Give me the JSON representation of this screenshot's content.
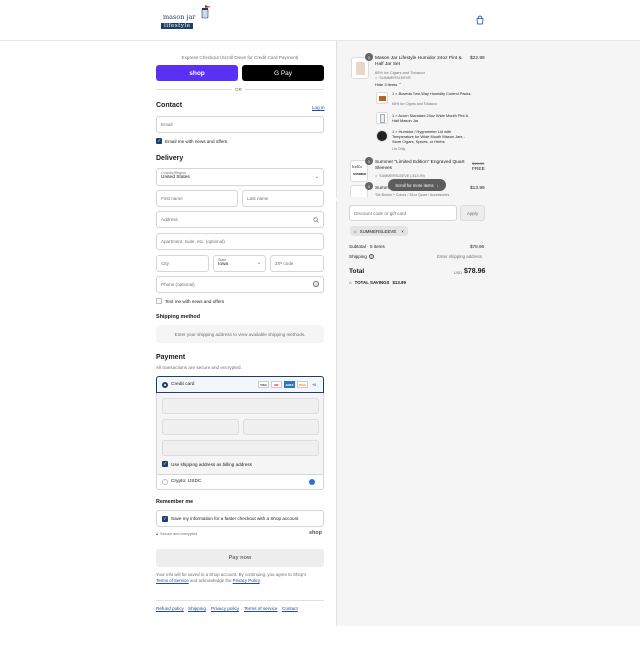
{
  "header": {
    "logo_line1": "mason jar",
    "logo_line2": "lifestyle"
  },
  "express": {
    "title": "Express Checkout (Scroll Down for Credit Card Payment)",
    "shop_pay": "shop",
    "gpay": "G Pay",
    "or": "OR"
  },
  "contact": {
    "title": "Contact",
    "login": "Log in",
    "email_placeholder": "Email",
    "newsletter": "Email me with news and offers"
  },
  "delivery": {
    "title": "Delivery",
    "country_label": "Country/Region",
    "country_value": "United States",
    "first_name": "First name",
    "last_name": "Last name",
    "address": "Address",
    "apartment": "Apartment, suite, etc. (optional)",
    "city": "City",
    "state_label": "State",
    "state_value": "Iowa",
    "zip": "ZIP code",
    "phone": "Phone (optional)",
    "text_me": "Text me with news and offers"
  },
  "shipping_method": {
    "title": "Shipping method",
    "placeholder": "Enter your shipping address to view available shipping methods."
  },
  "payment": {
    "title": "Payment",
    "subtitle": "All transactions are secure and encrypted.",
    "credit_card": "Credit card",
    "card_brands": [
      "VISA",
      "MC",
      "AMEX",
      "DISC",
      "+4"
    ],
    "billing_same": "Use shipping address as billing address",
    "crypto": "Crypto: USDC"
  },
  "remember": {
    "title": "Remember me",
    "save_info": "Save my information for a faster checkout with a Shop account",
    "secure": "Secure and encrypted",
    "shop_logo": "shop"
  },
  "pay_now": "Pay now",
  "legal": {
    "line1": "Your info will be saved to a Shop account. By continuing, you agree to Shop's",
    "terms": "Terms of Service",
    "and": "and acknowledge the",
    "privacy": "Privacy Policy"
  },
  "footer_links": [
    "Refund policy",
    "Shipping",
    "Privacy policy",
    "Terms of service",
    "Contact"
  ],
  "order": {
    "items": [
      {
        "qty": "1",
        "title": "Mason Jar Lifestyle Humidor 24oz Pint & Half Jar Set",
        "subtitle": "65% for Cigars and Tobacco",
        "discount": "SUMMERSLEEVE",
        "price": "$22.99",
        "hide_items": "Hide 3 items",
        "bundle": [
          {
            "title": "1 × Boveda Two-Way Humidity Control Packs",
            "subtitle": "65% for Cigars and Tobacco"
          },
          {
            "title": "1 × Acorn Standard 24oz Wide Mouth Pint & Half Mason Jar",
            "subtitle": ""
          },
          {
            "title": "1 × Humidor / Hygrometer Lid with Temperature for Wide Mouth Mason Jars - Store Cigars, Spices, or Herbs",
            "subtitle": "Lid Only"
          }
        ]
      },
      {
        "qty": "1",
        "title": "Summer \"Limited Edition\" Engraved Quart Sleeves",
        "discount": "SUMMERSLEEVE (-$13.99)",
        "old_price": "$13.99",
        "price": "FREE"
      },
      {
        "qty": "1",
        "title": "Summer Mason Jar Holder",
        "subtitle": "Tile Brown + Colors / 32oz Quart / Accessories",
        "price": "$13.99"
      }
    ],
    "scroll_hint": "Scroll for more items",
    "discount_placeholder": "Discount code or gift card",
    "apply": "Apply",
    "applied_code": "SUMMERSLEEVE",
    "subtotal_label": "Subtotal · 5 items",
    "subtotal_value": "$78.96",
    "shipping_label": "Shipping",
    "shipping_value": "Enter shipping address",
    "total_label": "Total",
    "currency": "USD",
    "total_value": "$78.96",
    "savings_label": "TOTAL SAVINGS",
    "savings_value": "$13.99"
  }
}
